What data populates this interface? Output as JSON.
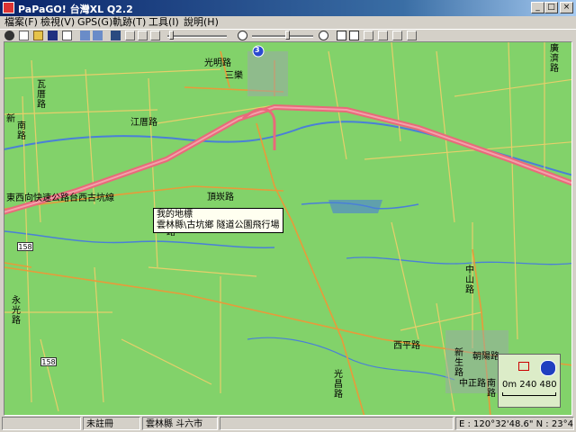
{
  "window": {
    "title": "PaPaGO! 台灣XL Q2.2"
  },
  "menu": [
    {
      "label": "檔案(F)"
    },
    {
      "label": "檢視(V)"
    },
    {
      "label": "GPS(G)"
    },
    {
      "label": "軌跡(T)"
    },
    {
      "label": "工具(I)"
    },
    {
      "label": "說明(H)"
    }
  ],
  "toolbar": {
    "route_badge": "3"
  },
  "map": {
    "tooltip": {
      "line1": "我的地標",
      "line2": "雲林縣\\古坑鄉 隧道公園飛行場"
    },
    "labels": {
      "guangming_rd": "光明路",
      "sanle": "三樂",
      "wali_rd": "瓦厝路",
      "xin": "新",
      "nan_rd": "南路",
      "jiangcuo_rd": "江厝路",
      "east_west_expressway": "東西向快速公路台西古坑線",
      "dingbei_rd": "頂崁路",
      "lu_left": "路",
      "yongguang_rd": "永光路",
      "zhongshan_rd": "中山路",
      "xiping_rd": "西平路",
      "guangchang_rd": "光昌路",
      "chaoyang_rd": "朝陽路",
      "xinsheng_rd": "新生路",
      "zhongzheng_rd": "中正路",
      "wen": "文",
      "lu_south": "南路",
      "top_right_rd": "廣濟路",
      "shield_158": "158",
      "shield_158b": "158"
    },
    "scale": {
      "values": "0m 240 480"
    }
  },
  "status": {
    "panel1": "",
    "panel2": "未註冊",
    "panel3": "雲林縣 斗六市",
    "panel4": "",
    "coords": "E : 120°32'48.6\"   N : 23°40'05.6"
  }
}
